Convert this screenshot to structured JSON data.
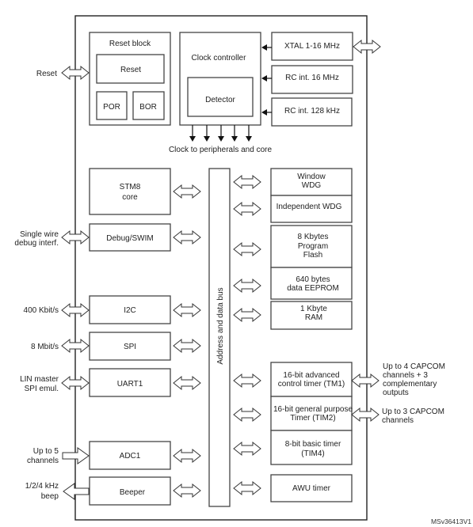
{
  "reset_block": {
    "title": "Reset block",
    "reset": "Reset",
    "por": "POR",
    "bor": "BOR"
  },
  "clock": {
    "controller": "Clock controller",
    "detector": "Detector",
    "caption": "Clock to peripherals and core",
    "sources": [
      "XTAL 1-16 MHz",
      "RC int. 16 MHz",
      "RC int. 128 kHz"
    ]
  },
  "bus_label": "Address and data bus",
  "left_blocks": {
    "core_line1": "STM8",
    "core_line2": "core",
    "debug": "Debug/SWIM",
    "i2c": "I2C",
    "spi": "SPI",
    "uart": "UART1",
    "adc": "ADC1",
    "beeper": "Beeper"
  },
  "right_blocks": {
    "wwdg_line1": "Window",
    "wwdg_line2": "WDG",
    "iwdg": "Independent WDG",
    "flash_line1": "8 Kbytes",
    "flash_line2": "Program",
    "flash_line3": "Flash",
    "eeprom_line1": "640 bytes",
    "eeprom_line2": "data EEPROM",
    "ram_line1": "1 Kbyte",
    "ram_line2": "RAM",
    "tim1_line1": "16-bit advanced",
    "tim1_line2": "control timer (TM1)",
    "tim2_line1": "16-bit general purpose",
    "tim2_line2": "Timer (TIM2)",
    "tim4_line1": "8-bit basic timer",
    "tim4_line2": "(TIM4)",
    "awu": "AWU timer"
  },
  "external_left": {
    "reset": "Reset",
    "swim_line1": "Single wire",
    "swim_line2": "debug interf.",
    "i2c": "400 Kbit/s",
    "spi": "8 Mbit/s",
    "uart_line1": "LIN master",
    "uart_line2": "SPI emul.",
    "adc_line1": "Up to 5",
    "adc_line2": "channels",
    "beep_line1": "1/2/4 kHz",
    "beep_line2": "beep"
  },
  "external_right": {
    "tim1_line1": "Up to 4 CAPCOM",
    "tim1_line2": "channels + 3",
    "tim1_line3": "complementary",
    "tim1_line4": "outputs",
    "tim2_line1": "Up to 3 CAPCOM",
    "tim2_line2": "channels"
  },
  "figure_id": "MSv36413V1"
}
